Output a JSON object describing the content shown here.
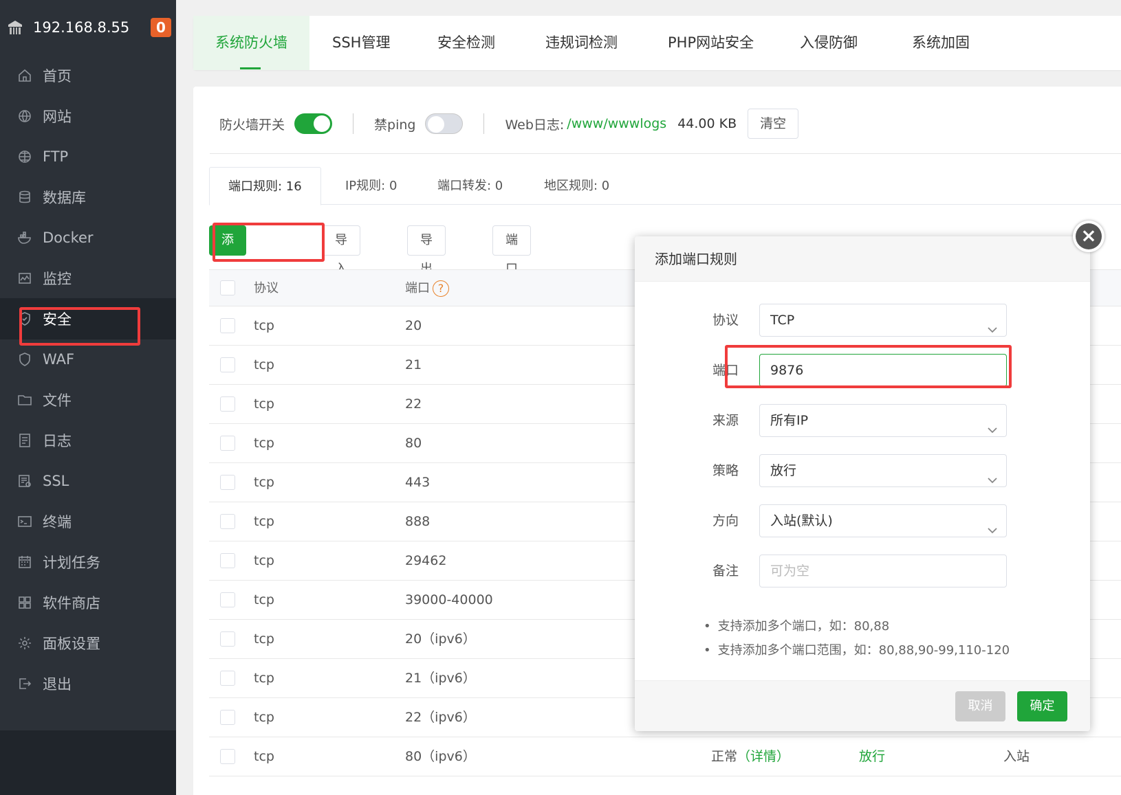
{
  "sidebar": {
    "host": "192.168.8.55",
    "badge": "0",
    "items": [
      {
        "label": "首页",
        "icon": "home-icon"
      },
      {
        "label": "网站",
        "icon": "globe-icon"
      },
      {
        "label": "FTP",
        "icon": "ftp-globe-icon"
      },
      {
        "label": "数据库",
        "icon": "database-icon"
      },
      {
        "label": "Docker",
        "icon": "docker-icon"
      },
      {
        "label": "监控",
        "icon": "monitor-icon"
      },
      {
        "label": "安全",
        "icon": "shield-icon"
      },
      {
        "label": "WAF",
        "icon": "waf-shield-icon"
      },
      {
        "label": "文件",
        "icon": "folder-icon"
      },
      {
        "label": "日志",
        "icon": "log-icon"
      },
      {
        "label": "SSL",
        "icon": "ssl-icon"
      },
      {
        "label": "终端",
        "icon": "terminal-icon"
      },
      {
        "label": "计划任务",
        "icon": "calendar-icon"
      },
      {
        "label": "软件商店",
        "icon": "apps-grid-icon"
      },
      {
        "label": "面板设置",
        "icon": "gear-icon"
      },
      {
        "label": "退出",
        "icon": "logout-icon"
      }
    ],
    "active_index": 6
  },
  "top_tabs": [
    "系统防火墙",
    "SSH管理",
    "安全检测",
    "违规词检测",
    "PHP网站安全",
    "入侵防御",
    "系统加固"
  ],
  "firewall": {
    "switch_label": "防火墙开关",
    "switch_on": true,
    "ping_label": "禁ping",
    "ping_on": false,
    "weblog_label": "Web日志:",
    "weblog_path": "/www/wwwlogs",
    "weblog_size": "44.00 KB",
    "clear_label": "清空"
  },
  "sub_tabs": [
    "端口规则: 16",
    "IP规则: 0",
    "端口转发: 0",
    "地区规则: 0"
  ],
  "actions": {
    "add": "添加端口规则",
    "import": "导入规则",
    "export": "导出规则",
    "scan": "端口防扫描"
  },
  "table": {
    "headers": {
      "protocol": "协议",
      "port": "端口",
      "help": "?"
    },
    "rows": [
      {
        "protocol": "tcp",
        "port": "20"
      },
      {
        "protocol": "tcp",
        "port": "21"
      },
      {
        "protocol": "tcp",
        "port": "22"
      },
      {
        "protocol": "tcp",
        "port": "80"
      },
      {
        "protocol": "tcp",
        "port": "443"
      },
      {
        "protocol": "tcp",
        "port": "888"
      },
      {
        "protocol": "tcp",
        "port": "29462"
      },
      {
        "protocol": "tcp",
        "port": "39000-40000"
      },
      {
        "protocol": "tcp",
        "port": "20（ipv6）"
      },
      {
        "protocol": "tcp",
        "port": "21（ipv6）"
      },
      {
        "protocol": "tcp",
        "port": "22（ipv6）"
      },
      {
        "protocol": "tcp",
        "port": "80（ipv6）",
        "status": "正常",
        "detail": "（详情）",
        "policy": "放行",
        "direction": "入站"
      }
    ]
  },
  "modal": {
    "title": "添加端口规则",
    "fields": {
      "protocol_label": "协议",
      "protocol_value": "TCP",
      "port_label": "端口",
      "port_value": "9876",
      "source_label": "来源",
      "source_value": "所有IP",
      "policy_label": "策略",
      "policy_value": "放行",
      "direction_label": "方向",
      "direction_value": "入站(默认)",
      "remark_label": "备注",
      "remark_placeholder": "可为空"
    },
    "tips": [
      "支持添加多个端口，如：80,88",
      "支持添加多个端口范围，如：80,88,90-99,110-120"
    ],
    "cancel": "取消",
    "confirm": "确定",
    "close_symbol": "×"
  },
  "colors": {
    "accent": "#20a53a",
    "sidebar_bg": "#2c3138",
    "highlight": "#f03c3c",
    "badge": "#e8622a"
  }
}
